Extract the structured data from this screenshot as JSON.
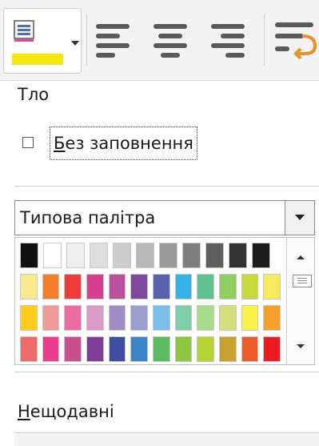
{
  "toolbar": {
    "background_button": {
      "icon": "background-color-icon",
      "current_color": "#f5e80f"
    },
    "align_buttons": [
      {
        "icon": "align-left-icon"
      },
      {
        "icon": "align-center-icon"
      },
      {
        "icon": "align-right-icon"
      }
    ],
    "wrap_button": {
      "icon": "text-wrap-icon"
    }
  },
  "background": {
    "section_label": "Тло",
    "no_fill_label": "Без заповнення",
    "no_fill_checked": false
  },
  "palette": {
    "selected": "Типова палітра",
    "swatches": [
      [
        "#101010",
        "#ffffff",
        "#eeeeee",
        "#dddddd",
        "#cccccc",
        "#b8b8b8",
        "#9a9a9a",
        "#7e7e7e",
        "#5e5e5e",
        "#333333",
        "#1c1c1c"
      ],
      [
        "#f8e98e",
        "#f57e2a",
        "#ef3b39",
        "#d83e8f",
        "#b9509b",
        "#7f4a9c",
        "#5662ac",
        "#36b3e6",
        "#5fc190",
        "#8fcf5f",
        "#c5d93b",
        "#f6ea5b"
      ],
      [
        "#ffcc1a",
        "#f19a9a",
        "#ec6ba4",
        "#d99ac6",
        "#a08cc3",
        "#9a9fd0",
        "#7bbfe8",
        "#7ecfa6",
        "#a6d98a",
        "#d3df7a",
        "#f9f04a",
        "#f7a12a"
      ],
      [
        "#ef6b6b",
        "#ee3d8e",
        "#c9508f",
        "#7f3e98",
        "#3f4ea0",
        "#3a86c8",
        "#5bba62",
        "#8dc63f",
        "#b5d333",
        "#c8a12f",
        "#ee5b2a",
        "#ed1c24"
      ]
    ]
  },
  "recent": {
    "label": "Нещодавні"
  }
}
